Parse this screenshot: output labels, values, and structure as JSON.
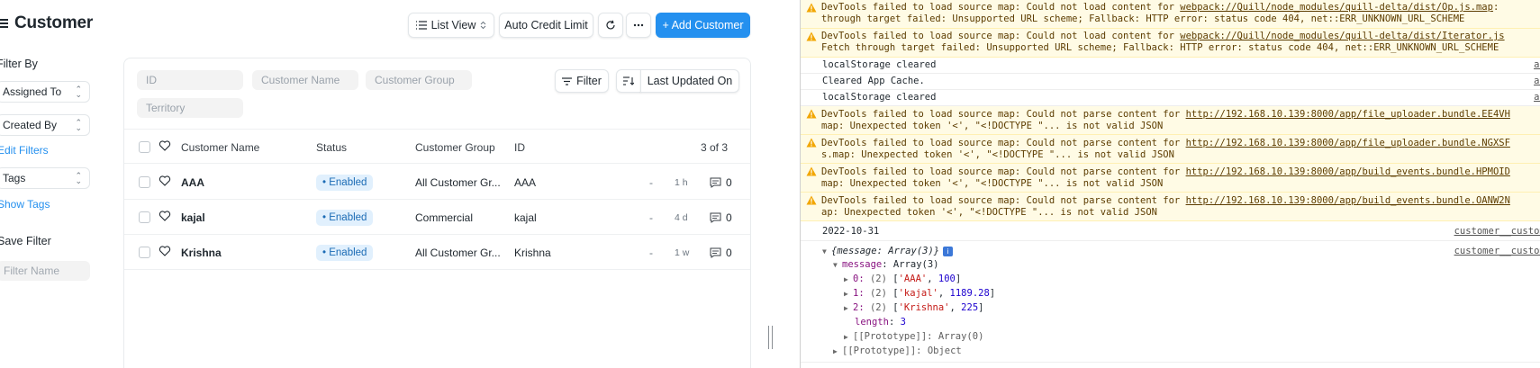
{
  "app": {
    "title": "Customer",
    "toolbar": {
      "list_view_label": "List View",
      "auto_credit_label": "Auto Credit Limit",
      "add_label": "+ Add Customer"
    },
    "sidebar": {
      "filter_by": "Filter By",
      "assigned_to": "Assigned To",
      "created_by": "Created By",
      "edit_filters": "Edit Filters",
      "tags": "Tags",
      "show_tags": "Show Tags",
      "save_filter": "Save Filter",
      "filter_name_placeholder": "Filter Name"
    },
    "filters": {
      "id_placeholder": "ID",
      "customer_name_placeholder": "Customer Name",
      "customer_group_placeholder": "Customer Group",
      "territory_placeholder": "Territory",
      "filter_label": "Filter",
      "sort_label": "Last Updated On"
    },
    "table": {
      "headers": {
        "name": "Customer Name",
        "status": "Status",
        "group": "Customer Group",
        "id": "ID",
        "count": "3 of 3"
      },
      "rows": [
        {
          "name": "AAA",
          "status": "Enabled",
          "group": "All Customer Gr...",
          "id": "AAA",
          "dash": "-",
          "time": "1 h",
          "comments": "0"
        },
        {
          "name": "kajal",
          "status": "Enabled",
          "group": "Commercial",
          "id": "kajal",
          "dash": "-",
          "time": "4 d",
          "comments": "0"
        },
        {
          "name": "Krishna",
          "status": "Enabled",
          "group": "All Customer Gr...",
          "id": "Krishna",
          "dash": "-",
          "time": "1 w",
          "comments": "0"
        }
      ]
    }
  },
  "console": {
    "messages": [
      {
        "type": "warn",
        "line1_pre": "DevTools failed to load source map: Could not load content for ",
        "line1_url": "webpack://Quill/node_modules/quill-delta/dist/Op.js.map",
        "line1_post": ":",
        "line2": "through target failed: Unsupported URL scheme; Fallback: HTTP error: status code 404, net::ERR_UNKNOWN_URL_SCHEME"
      },
      {
        "type": "warn",
        "line1_pre": "DevTools failed to load source map: Could not load content for ",
        "line1_url": "webpack://Quill/node_modules/quill-delta/dist/Iterator.js",
        "line1_post": "",
        "line2": "Fetch through target failed: Unsupported URL scheme; Fallback: HTTP error: status code 404, net::ERR_UNKNOWN_URL_SCHEME"
      },
      {
        "type": "log",
        "text": "localStorage cleared",
        "source": "assets"
      },
      {
        "type": "log",
        "text": "Cleared App Cache.",
        "source": "assets"
      },
      {
        "type": "log",
        "text": "localStorage cleared",
        "source": "assets"
      },
      {
        "type": "warn",
        "line1_pre": "DevTools failed to load source map: Could not parse content for ",
        "line1_url": "http://192.168.10.139:8000/app/file_uploader.bundle.EE4VH",
        "line1_post": "",
        "line2": "map: Unexpected token '<', \"<!DOCTYPE \"... is not valid JSON"
      },
      {
        "type": "warn",
        "line1_pre": "DevTools failed to load source map: Could not parse content for ",
        "line1_url": "http://192.168.10.139:8000/app/file_uploader.bundle.NGXSF",
        "line1_post": "",
        "line2": "s.map: Unexpected token '<', \"<!DOCTYPE \"... is not valid JSON"
      },
      {
        "type": "warn",
        "line1_pre": "DevTools failed to load source map: Could not parse content for ",
        "line1_url": "http://192.168.10.139:8000/app/build_events.bundle.HPMOID",
        "line1_post": "",
        "line2": "map: Unexpected token '<', \"<!DOCTYPE \"... is not valid JSON"
      },
      {
        "type": "warn",
        "line1_pre": "DevTools failed to load source map: Could not parse content for ",
        "line1_url": "http://192.168.10.139:8000/app/build_events.bundle.OANW2N",
        "line1_post": "",
        "line2": "ap: Unexpected token '<', \"<!DOCTYPE \"... is not valid JSON"
      },
      {
        "type": "log",
        "text": "2022-10-31",
        "source": "customer__custom_lis"
      }
    ],
    "object": {
      "summary_pre": "{message: Array(3)}",
      "source": "customer__custom_lis",
      "message_key": "message",
      "message_val": "Array(3)",
      "items": [
        {
          "idx": "0",
          "len": "(2)",
          "name": "'AAA'",
          "num": "100"
        },
        {
          "idx": "1",
          "len": "(2)",
          "name": "'kajal'",
          "num": "1189.28"
        },
        {
          "idx": "2",
          "len": "(2)",
          "name": "'Krishna'",
          "num": "225"
        }
      ],
      "length_key": "length",
      "length_val": "3",
      "proto_array": "[[Prototype]]: Array(0)",
      "proto_object": "[[Prototype]]: Object"
    }
  }
}
